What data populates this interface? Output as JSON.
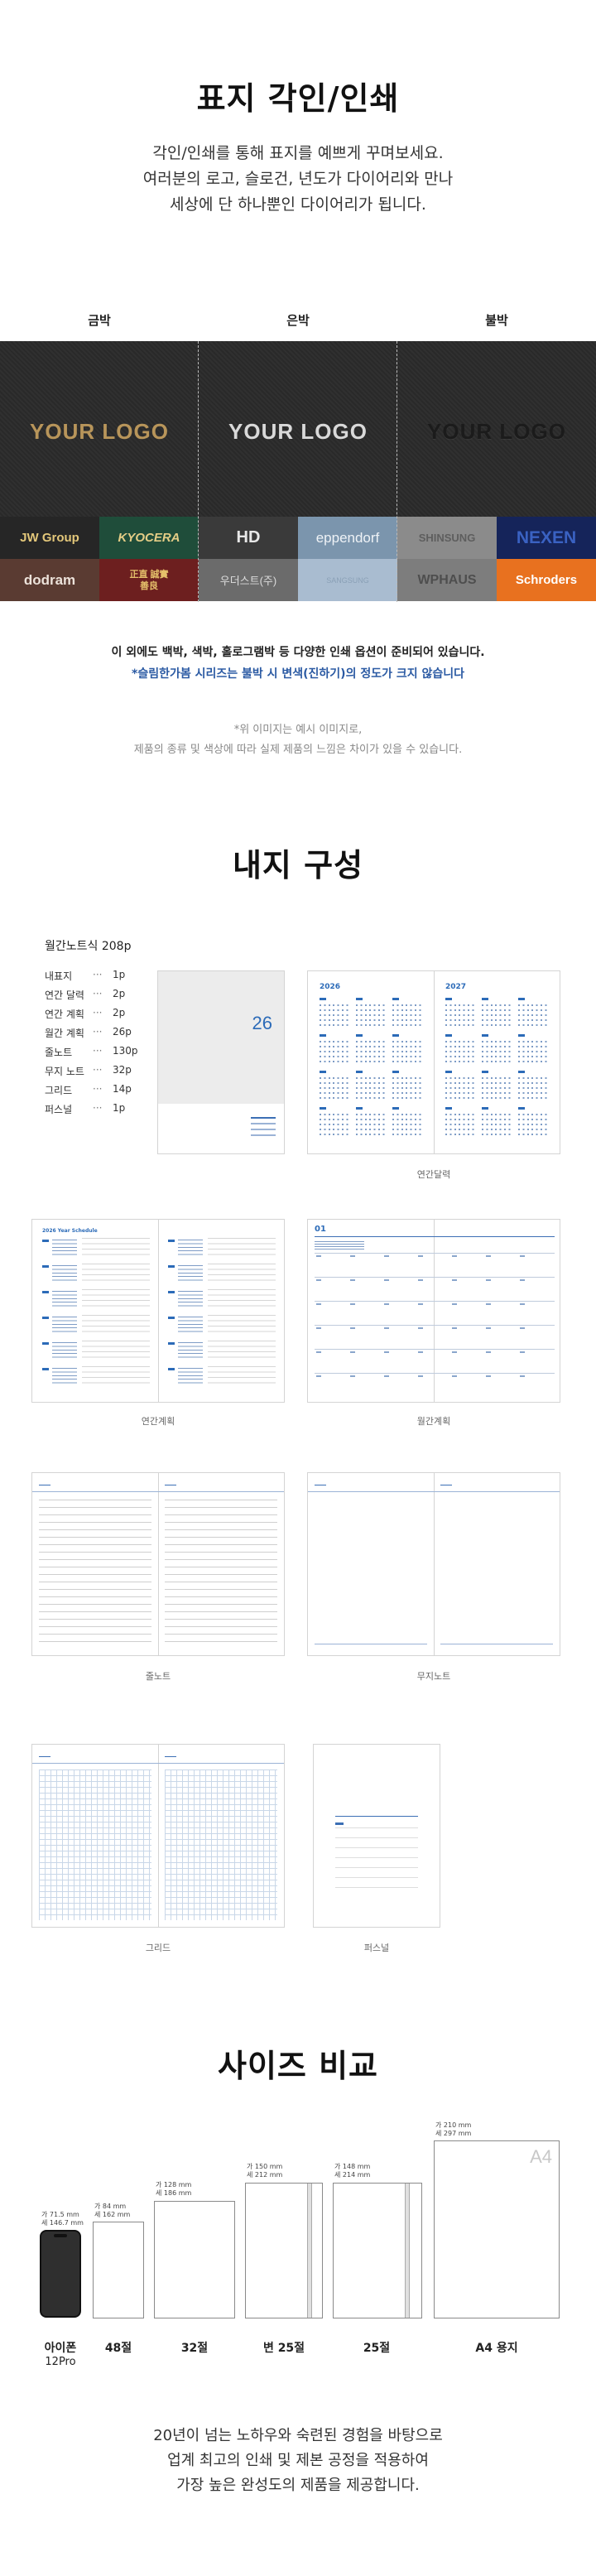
{
  "cover": {
    "title": "표지 각인/인쇄",
    "desc": [
      "각인/인쇄를 통해 표지를 예쁘게 꾸며보세요.",
      "여러분의 로고, 슬로건, 년도가 다이어리와 만나",
      "세상에 단 하나뿐인 다이어리가 됩니다."
    ],
    "methods": [
      "금박",
      "은박",
      "불박"
    ],
    "logo_text": "YOUR LOGO",
    "brands": [
      "JW Group",
      "KYOCERA",
      "HD",
      "eppendorf",
      "SHINSUNG",
      "NEXEN",
      "dodram",
      "正直 誠實 善良",
      "우더스트(주)",
      "SANGSUNG",
      "WPHAUS",
      "Schroders"
    ],
    "note1": "이 외에도 백박, 색박, 홀로그램박 등 다양한 인쇄 옵션이 준비되어 있습니다.",
    "note2": "*슬림한가봄 시리즈는 불박 시 변색(진하기)의 정도가 크지 않습니다",
    "disclaimer": [
      "*위 이미지는 예시 이미지로,",
      "제품의 종류 및 색상에 따라 실제 제품의 느낌은 차이가 있을 수 있습니다."
    ],
    "colors": {
      "gold": "#b8955a",
      "silver": "#d9d9d9",
      "emboss": "#1e1e1e",
      "band": "#2b2b2b"
    }
  },
  "inner": {
    "title": "내지 구성",
    "subtitle": "월간노트식 208p",
    "specs": [
      {
        "name": "내표지",
        "dots": "···",
        "pages": "1p"
      },
      {
        "name": "연간 달력",
        "dots": "···",
        "pages": "2p"
      },
      {
        "name": "연간 계획",
        "dots": "···",
        "pages": "2p"
      },
      {
        "name": "월간 계획",
        "dots": "···",
        "pages": "26p"
      },
      {
        "name": "줄노트",
        "dots": "···",
        "pages": "130p"
      },
      {
        "name": "무지 노트",
        "dots": "···",
        "pages": "32p"
      },
      {
        "name": "그리드",
        "dots": "···",
        "pages": "14p"
      },
      {
        "name": "퍼스널",
        "dots": "···",
        "pages": "1p"
      }
    ],
    "cover_number": "26",
    "cal_years": [
      "2026",
      "2027"
    ],
    "yearly_title": "2026 Year Schedule",
    "monthly_num": "01",
    "captions": {
      "calendar": "연간달력",
      "yearly": "연간계획",
      "monthly": "월간계획",
      "lined": "줄노트",
      "blank": "무지노트",
      "grid": "그리드",
      "personal": "퍼스널"
    }
  },
  "size": {
    "title": "사이즈 비교",
    "items": [
      {
        "label": "아이폰",
        "label2": "12Pro",
        "w": "가 71.5 mm",
        "h": "세 146.7 mm"
      },
      {
        "label": "48절",
        "w": "가 84 mm",
        "h": "세 162 mm"
      },
      {
        "label": "32절",
        "w": "가 128 mm",
        "h": "세 186 mm"
      },
      {
        "label": "변 25절",
        "w": "가 150 mm",
        "h": "세 212 mm"
      },
      {
        "label": "25절",
        "w": "가 148 mm",
        "h": "세 214 mm"
      },
      {
        "label": "A4 용지",
        "w": "가 210 mm",
        "h": "세 297 mm",
        "tag": "A4"
      }
    ],
    "closing": [
      "20년이 넘는 노하우와 숙련된 경험을 바탕으로",
      "업계 최고의 인쇄 및 제본 공정을 적용하여",
      "가장 높은 완성도의 제품을 제공합니다."
    ]
  }
}
